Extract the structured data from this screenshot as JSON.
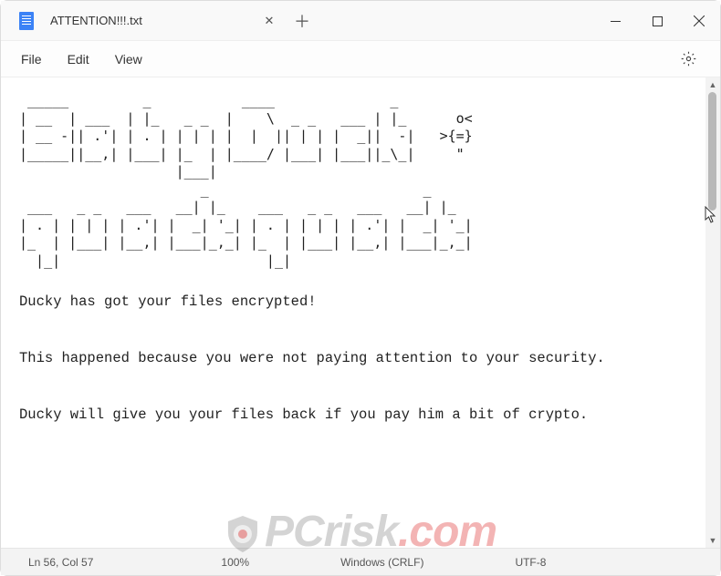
{
  "window": {
    "tab_title": "ATTENTION!!!.txt",
    "close_tab_glyph": "✕",
    "new_tab_glyph": "＋"
  },
  "menu": {
    "items": [
      "File",
      "Edit",
      "View"
    ]
  },
  "content": {
    "ascii_art": " _____         _           ____              _\n| __  | ___  | |_   _ _  |    \\  _ _   ___ | |_      o<\n| __ -|| .'| | . | | | | |  |  || | | |  _||  -|   >{=}\n|_____||__,| |___| |_  | |____/ |___| |___||_\\_|     \"\n                   |___|\n                      _                          _\n ___   _ _   ___   __| |_    ___   _ _   ___   __| |_\n| . | | | | | .'| |  _| '_| | . | | | | | .'| |  _| '_|\n|_  | |___| |__,| |___|_,_| |_  | |___| |__,| |___|_,_|\n  |_|                         |_|",
    "body": "Ducky has got your files encrypted!\n\nThis happened because you were not paying attention to your security.\n\nDucky will give you your files back if you pay him a bit of crypto."
  },
  "status": {
    "cursor": "Ln 56, Col 57",
    "zoom": "100%",
    "eol": "Windows (CRLF)",
    "encoding": "UTF-8"
  },
  "watermark": {
    "text_main": "PCrisk",
    "text_suffix": ".com"
  }
}
